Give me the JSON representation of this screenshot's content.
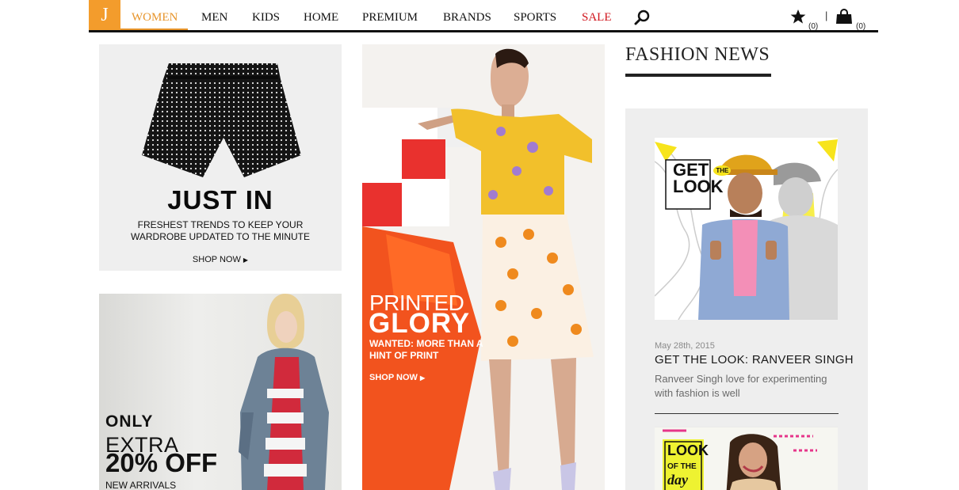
{
  "logo": {
    "letter": "J"
  },
  "nav": {
    "items": [
      "WOMEN",
      "MEN",
      "KIDS",
      "HOME",
      "PREMIUM",
      "BRANDS",
      "SPORTS",
      "SALE"
    ],
    "active": "WOMEN",
    "wishlist_count": "(0)",
    "cart_count": "(0)",
    "divider": "|"
  },
  "tiles": {
    "just_in": {
      "heading": "JUST IN",
      "subtext": "FRESHEST TRENDS TO KEEP YOUR WARDROBE UPDATED TO THE MINUTE",
      "cta": "SHOP NOW"
    },
    "printed_glory": {
      "line1": "PRINTED",
      "line2": "GLORY",
      "subtext": "WANTED: MORE THAN A HINT OF PRINT",
      "cta": "SHOP NOW"
    },
    "only": {
      "brand": "ONLY",
      "line1": "EXTRA",
      "line2": "20% OFF",
      "line3": "NEW ARRIVALS"
    }
  },
  "fashion_news": {
    "title": "FASHION NEWS",
    "article": {
      "badge_get": "GET",
      "badge_the": "THE",
      "badge_look": "LOOK",
      "date": "May 28th, 2015",
      "headline": "GET THE LOOK: RANVEER SINGH",
      "description": "Ranveer Singh love for experimenting with fashion is well"
    },
    "next_article": {
      "badge_look": "LOOK",
      "badge_of_the": "OF THE",
      "badge_day": "day"
    }
  },
  "colors": {
    "accent": "#e7942a",
    "sale": "#d0141c",
    "nav_rule": "#111111",
    "panel": "#eeeeee"
  }
}
